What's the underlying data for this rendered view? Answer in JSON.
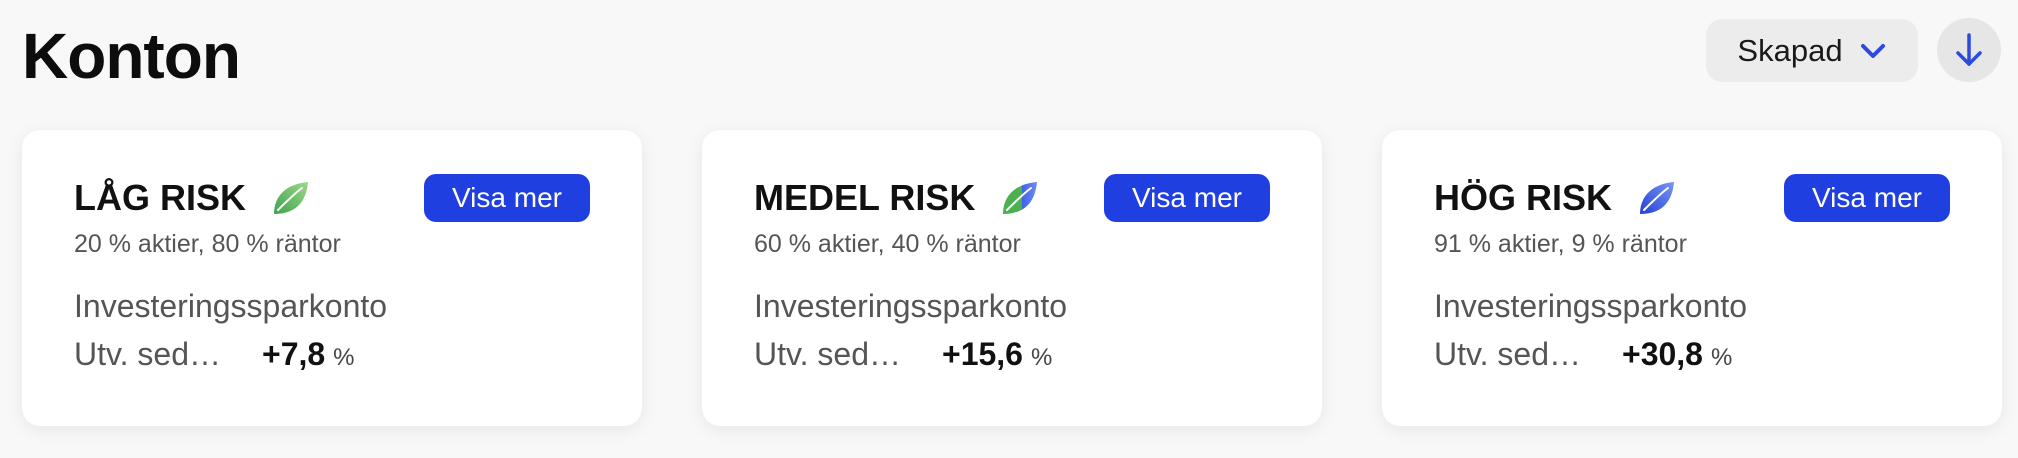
{
  "header": {
    "title": "Konton",
    "sort_label": "Skapad",
    "sort_icon": "chevron-down-icon",
    "direction_icon": "arrow-down-icon"
  },
  "colors": {
    "accent": "#1f3fe0",
    "leaf_green": "#4caf50",
    "leaf_blue": "#2b4fe0"
  },
  "cards": [
    {
      "name": "LÅG RISK",
      "icon": "leaf-green-icon",
      "button_label": "Visa mer",
      "allocation": "20 % aktier, 80 % räntor",
      "account_type": "Investeringssparkonto",
      "dev_label": "Utv. sed…",
      "dev_value": "+7,8",
      "dev_unit": "%"
    },
    {
      "name": "MEDEL RISK",
      "icon": "leaf-green-blue-icon",
      "button_label": "Visa mer",
      "allocation": "60 % aktier, 40 % räntor",
      "account_type": "Investeringssparkonto",
      "dev_label": "Utv. sed…",
      "dev_value": "+15,6",
      "dev_unit": "%"
    },
    {
      "name": "HÖG RISK",
      "icon": "leaf-blue-icon",
      "button_label": "Visa mer",
      "allocation": "91 % aktier, 9 % räntor",
      "account_type": "Investeringssparkonto",
      "dev_label": "Utv. sed…",
      "dev_value": "+30,8",
      "dev_unit": "%"
    }
  ]
}
